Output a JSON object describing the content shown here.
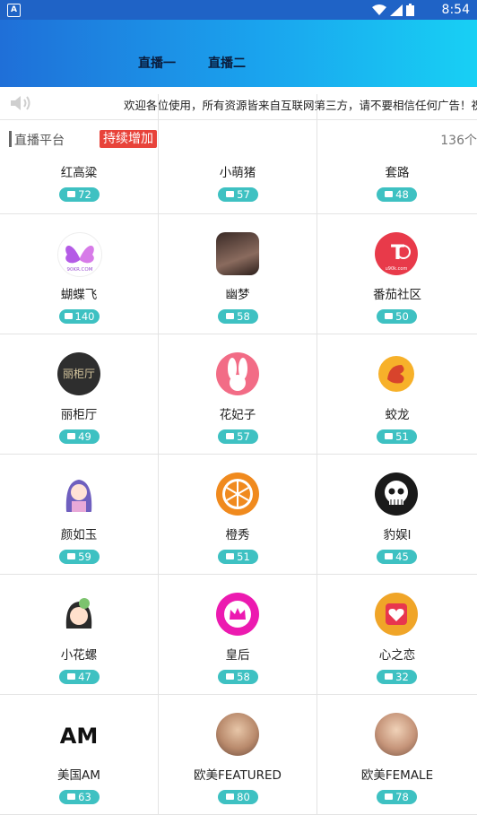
{
  "status_bar": {
    "time": "8:54",
    "app_icon_letter": "A"
  },
  "header": {
    "tabs": [
      "直播一",
      "直播二"
    ]
  },
  "notice": {
    "text": "欢迎各位使用，所有资源皆来自互联网第三方，请不要相信任何广告！祝您使用愉快"
  },
  "section": {
    "title": "直播平台",
    "badge": "持续增加",
    "count": "136个"
  },
  "platforms": [
    {
      "name": "红高粱",
      "count": "72",
      "icon": "partial-row-no-logo"
    },
    {
      "name": "小萌猪",
      "count": "57",
      "icon": "partial-row-no-logo"
    },
    {
      "name": "套路",
      "count": "48",
      "icon": "partial-row-no-logo"
    },
    {
      "name": "蝴蝶飞",
      "count": "140",
      "icon": "butterfly-logo-icon"
    },
    {
      "name": "幽梦",
      "count": "58",
      "icon": "photo-avatar-icon"
    },
    {
      "name": "番茄社区",
      "count": "50",
      "icon": "tomato-logo-icon"
    },
    {
      "name": "丽柜厅",
      "count": "49",
      "icon": "text-logo-icon"
    },
    {
      "name": "花妃子",
      "count": "57",
      "icon": "rabbit-logo-icon"
    },
    {
      "name": "蛟龙",
      "count": "51",
      "icon": "dragon-logo-icon"
    },
    {
      "name": "颜如玉",
      "count": "59",
      "icon": "anime-girl-icon"
    },
    {
      "name": "橙秀",
      "count": "51",
      "icon": "orange-slice-icon"
    },
    {
      "name": "豹娱l",
      "count": "45",
      "icon": "skull-logo-icon"
    },
    {
      "name": "小花螺",
      "count": "47",
      "icon": "cartoon-girl-icon"
    },
    {
      "name": "皇后",
      "count": "58",
      "icon": "crown-logo-icon"
    },
    {
      "name": "心之恋",
      "count": "32",
      "icon": "heart-logo-icon"
    },
    {
      "name": "美国AM",
      "count": "63",
      "icon": "am-logo-icon"
    },
    {
      "name": "欧美FEATURED",
      "count": "80",
      "icon": "photo-avatar-icon"
    },
    {
      "name": "欧美FEMALE",
      "count": "78",
      "icon": "photo-avatar-icon"
    }
  ],
  "logo_text": {
    "butterfly": "90KR.COM",
    "tomato": "T",
    "tomato_sub": "u90k.com",
    "text_logo": "丽柜厅",
    "am": "AM"
  },
  "colors": {
    "header_start": "#1f6fd8",
    "header_end": "#18d0f4",
    "pill": "#3ec1c2",
    "badge": "#e8433a",
    "crown_bg": "#ec1ab0",
    "tomato_bg": "#e83a4a",
    "orange": "#f08a1e"
  }
}
